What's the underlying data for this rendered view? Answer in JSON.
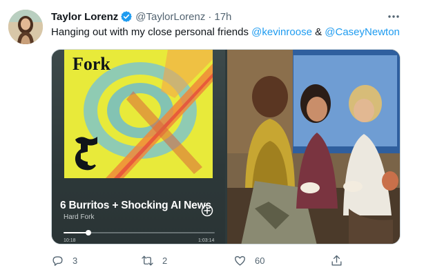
{
  "tweet": {
    "author_name": "Taylor Lorenz",
    "handle": "@TaylorLorenz",
    "separator": "·",
    "time": "17h",
    "text_before": "Hanging out with my close personal friends ",
    "mention_1": "@kevinroose",
    "text_between": " & ",
    "mention_2": "@CaseyNewton",
    "media": {
      "podcast_logo": "Fork",
      "episode_title": "6 Burritos + Shocking AI News",
      "show_name": "Hard Fork",
      "elapsed": "10:18",
      "total": "1:03:14",
      "progress": 0.163
    },
    "actions": {
      "replies": "3",
      "retweets": "2",
      "likes": "60"
    }
  },
  "icons": {
    "verified": "verified-badge-icon",
    "more": "more-dots-icon",
    "reply": "reply-icon",
    "retweet": "retweet-icon",
    "like": "heart-icon",
    "share": "share-icon",
    "add": "plus-circle-icon"
  },
  "colors": {
    "link": "#1d9bf0",
    "text_secondary": "#536471",
    "verified": "#1d9bf0",
    "podcast_art_bg": "#e8ea3a",
    "player_bg": "#2d3839"
  }
}
